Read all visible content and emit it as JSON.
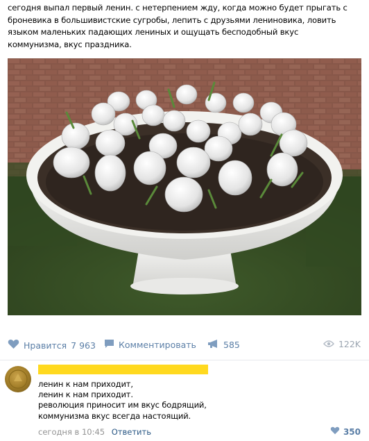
{
  "post": {
    "text_lines": [
      "сегодня выпал первый ленин. с нетерпением жду, когда можно будет прыгать с",
      "броневика в большивистские сугробы, лепить с друзьями лениновика, ловить",
      "языком маленьких падающих лениных и ощущать бесподобный вкус",
      "коммунизма, вкус праздника."
    ]
  },
  "actions": {
    "like_label": "Нравится",
    "like_count": "7 963",
    "comment_label": "Комментировать",
    "share_count": "585",
    "views_count": "122K"
  },
  "comment": {
    "text_lines": [
      "ленин к нам приходит,",
      "ленин к нам приходит.",
      "революция приносит им вкус бодрящий,",
      "коммунизма вкус всегда настоящий."
    ],
    "time": "сегодня в 10:45",
    "reply_label": "Ответить",
    "like_count": "350"
  },
  "colors": {
    "link": "#2a5885",
    "action_blue": "#5a7ea6",
    "muted": "#939393",
    "redaction": "#ffd91f"
  }
}
